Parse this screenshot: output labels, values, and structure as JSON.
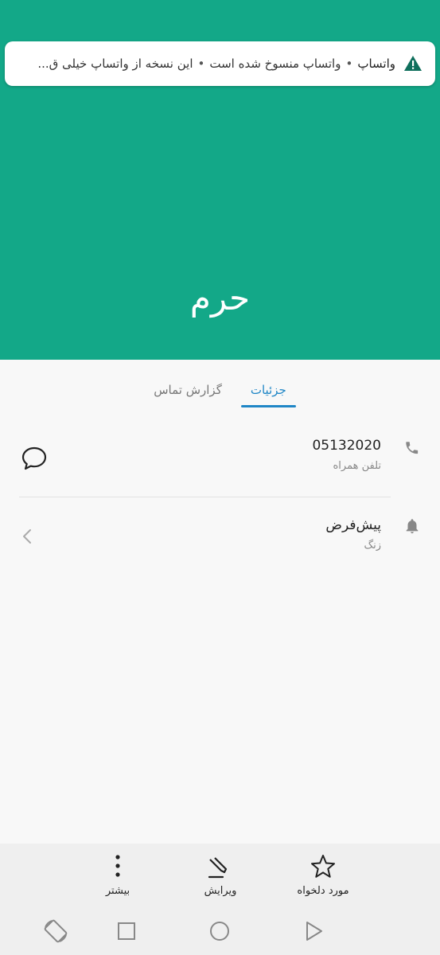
{
  "notification": {
    "app": "واتساپ",
    "title": "واتساپ منسوخ شده است",
    "body": "این نسخه از واتساپ خیلی ق...",
    "separator": "•"
  },
  "contact": {
    "name": "حرم"
  },
  "tabs": [
    {
      "label": "جزئیات",
      "active": true
    },
    {
      "label": "گزارش تماس",
      "active": false
    }
  ],
  "phone": {
    "number": "05132020",
    "type": "تلفن همراه"
  },
  "ringtone": {
    "value": "پیش‌فرض",
    "label": "زنگ"
  },
  "actions": {
    "favorite_label": "مورد دلخواه",
    "edit_label": "ویرایش",
    "more_label": "بیشتر"
  },
  "colors": {
    "header": "#13a888",
    "accent": "#1f86c6",
    "warning": "#0f6f5c"
  }
}
